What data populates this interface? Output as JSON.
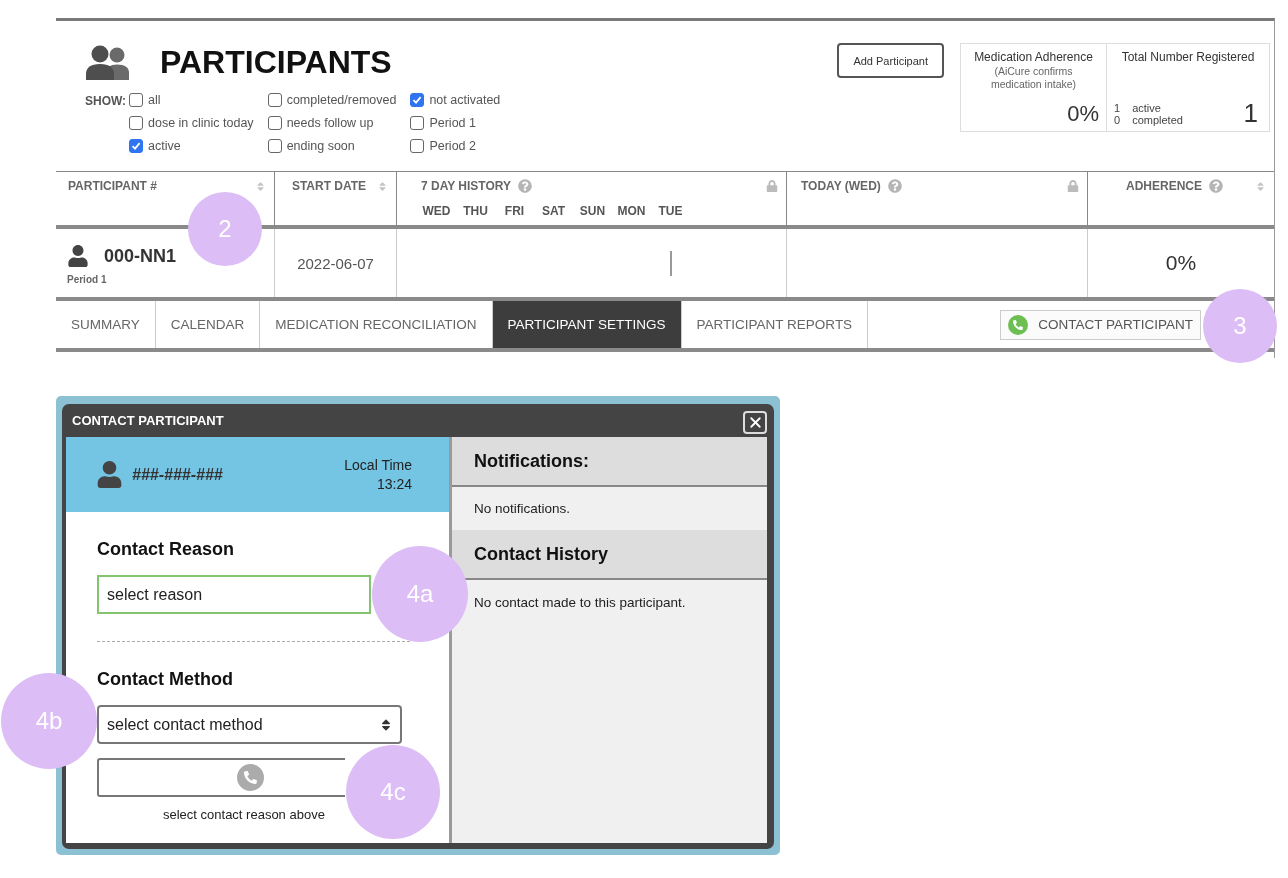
{
  "header": {
    "title": "PARTICIPANTS",
    "show_label": "SHOW:",
    "add_button": "Add Participant"
  },
  "filters": [
    {
      "label": "all",
      "checked": false
    },
    {
      "label": "dose in clinic today",
      "checked": false
    },
    {
      "label": "active",
      "checked": true
    },
    {
      "label": "completed/removed",
      "checked": false
    },
    {
      "label": "needs follow up",
      "checked": false
    },
    {
      "label": "ending soon",
      "checked": false
    },
    {
      "label": "not activated",
      "checked": true
    },
    {
      "label": "Period 1",
      "checked": false
    },
    {
      "label": "Period 2",
      "checked": false
    }
  ],
  "stats": {
    "adherence": {
      "title": "Medication Adherence",
      "subtitle": "(AiCure confirms medication intake)",
      "value": "0%"
    },
    "registered": {
      "title": "Total Number Registered",
      "counts": [
        {
          "count": "1",
          "label": "active"
        },
        {
          "count": "0",
          "label": "completed"
        }
      ],
      "total": "1"
    }
  },
  "table": {
    "columns": [
      {
        "label": "PARTICIPANT #",
        "sortable": true,
        "help": false,
        "locked": false
      },
      {
        "label": "START DATE",
        "sortable": true,
        "help": false,
        "locked": false
      },
      {
        "label": "7 DAY HISTORY",
        "sortable": false,
        "help": true,
        "locked": true,
        "days": [
          "WED",
          "THU",
          "FRI",
          "SAT",
          "SUN",
          "MON",
          "TUE"
        ]
      },
      {
        "label": "TODAY (WED)",
        "sortable": false,
        "help": true,
        "locked": true
      },
      {
        "label": "ADHERENCE",
        "sortable": true,
        "help": true,
        "locked": false
      }
    ],
    "rows": [
      {
        "participant": "000-NN1",
        "period": "Period 1",
        "start_date": "2022-06-07",
        "adherence": "0%"
      }
    ]
  },
  "tabs": [
    {
      "label": "SUMMARY",
      "selected": false
    },
    {
      "label": "CALENDAR",
      "selected": false
    },
    {
      "label": "MEDICATION RECONCILIATION",
      "selected": false
    },
    {
      "label": "PARTICIPANT SETTINGS",
      "selected": true
    },
    {
      "label": "PARTICIPANT REPORTS",
      "selected": false
    }
  ],
  "contact_button": "CONTACT PARTICIPANT",
  "dialog": {
    "title": "CONTACT PARTICIPANT",
    "participant": "###-###-###",
    "local_time_label": "Local Time",
    "local_time": "13:24",
    "fields": [
      {
        "kind": "plain",
        "heading": "Contact Reason",
        "placeholder": "select reason",
        "focused": true
      },
      {
        "kind": "dropdown",
        "heading": "Contact Method",
        "placeholder": "select contact method",
        "focused": false
      }
    ],
    "call": {
      "hint": "select contact reason above",
      "disabled": true
    },
    "notifications": {
      "heading": "Notifications:",
      "text": "No notifications."
    },
    "contact_history": {
      "heading": "Contact History",
      "text": "No contact made to this participant."
    }
  },
  "callouts": [
    {
      "label": "2"
    },
    {
      "label": "3"
    },
    {
      "label": "4a"
    },
    {
      "label": "4b"
    },
    {
      "label": "4c"
    }
  ]
}
